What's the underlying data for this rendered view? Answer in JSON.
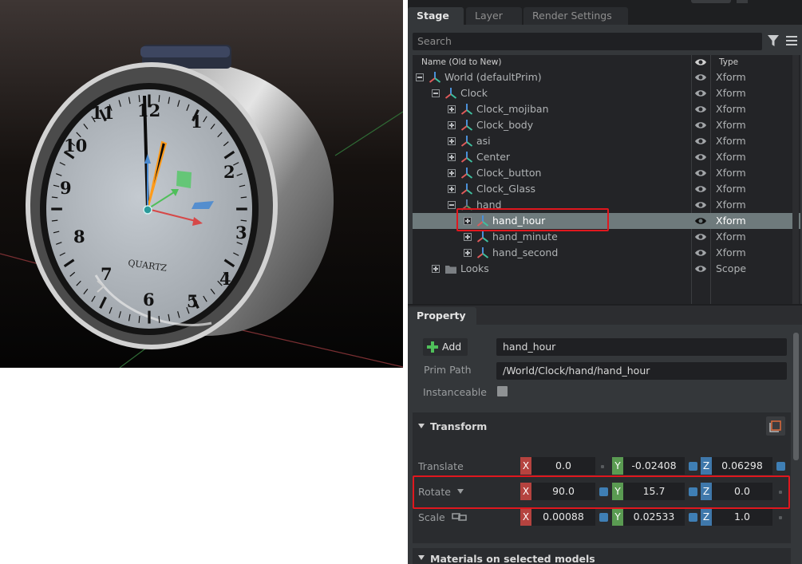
{
  "viewport": {
    "clock_face": {
      "numerals": [
        "12",
        "1",
        "2",
        "3",
        "4",
        "5",
        "6",
        "7",
        "8",
        "9",
        "10",
        "11"
      ],
      "brand": "QUARTZ"
    }
  },
  "stage_window": {
    "tabs": [
      {
        "label": "Stage",
        "active": true
      },
      {
        "label": "Layer",
        "active": false
      },
      {
        "label": "Render Settings",
        "active": false
      }
    ],
    "search": {
      "placeholder": "Search"
    },
    "columns": {
      "name": "Name (Old to New)",
      "type": "Type"
    },
    "tree": [
      {
        "label": "World (defaultPrim)",
        "type": "Xform",
        "expander": "minus",
        "icon": "xform-icon"
      },
      {
        "label": "Clock",
        "type": "Xform",
        "expander": "minus",
        "icon": "xform-icon"
      },
      {
        "label": "Clock_mojiban",
        "type": "Xform",
        "expander": "plus",
        "icon": "xform-icon"
      },
      {
        "label": "Clock_body",
        "type": "Xform",
        "expander": "plus",
        "icon": "xform-icon"
      },
      {
        "label": "asi",
        "type": "Xform",
        "expander": "plus",
        "icon": "xform-icon"
      },
      {
        "label": "Center",
        "type": "Xform",
        "expander": "plus",
        "icon": "xform-icon"
      },
      {
        "label": "Clock_button",
        "type": "Xform",
        "expander": "plus",
        "icon": "xform-icon"
      },
      {
        "label": "Clock_Glass",
        "type": "Xform",
        "expander": "plus",
        "icon": "xform-icon"
      },
      {
        "label": "hand",
        "type": "Xform",
        "expander": "minus",
        "icon": "xform-icon"
      },
      {
        "label": "hand_hour",
        "type": "Xform",
        "expander": "plus",
        "icon": "xform-icon",
        "selected": true
      },
      {
        "label": "hand_minute",
        "type": "Xform",
        "expander": "plus",
        "icon": "xform-icon"
      },
      {
        "label": "hand_second",
        "type": "Xform",
        "expander": "plus",
        "icon": "xform-icon"
      },
      {
        "label": "Looks",
        "type": "Scope",
        "expander": "plus",
        "icon": "folder-icon"
      }
    ]
  },
  "property_window": {
    "tab": "Property",
    "add_label": "Add",
    "prim_name": "hand_hour",
    "prim_path_label": "Prim Path",
    "prim_path": "/World/Clock/hand/hand_hour",
    "instanceable_label": "Instanceable",
    "instanceable_checked": false,
    "transform": {
      "title": "Transform",
      "translate": {
        "label": "Translate",
        "x": "0.0",
        "y": "-0.02408",
        "z": "0.06298"
      },
      "rotate": {
        "label": "Rotate",
        "x": "90.0",
        "y": "15.7",
        "z": "0.0"
      },
      "scale": {
        "label": "Scale",
        "x": "0.00088",
        "y": "0.02533",
        "z": "1.0"
      },
      "axis_labels": {
        "x": "X",
        "y": "Y",
        "z": "Z"
      }
    },
    "materials_section": {
      "title": "Materials on selected models"
    }
  },
  "colors": {
    "highlight": "#e0171e",
    "axis_x": "#b5433f",
    "axis_y": "#5a9b52",
    "axis_z": "#3f78ab",
    "selection": "#6e7a7c"
  }
}
